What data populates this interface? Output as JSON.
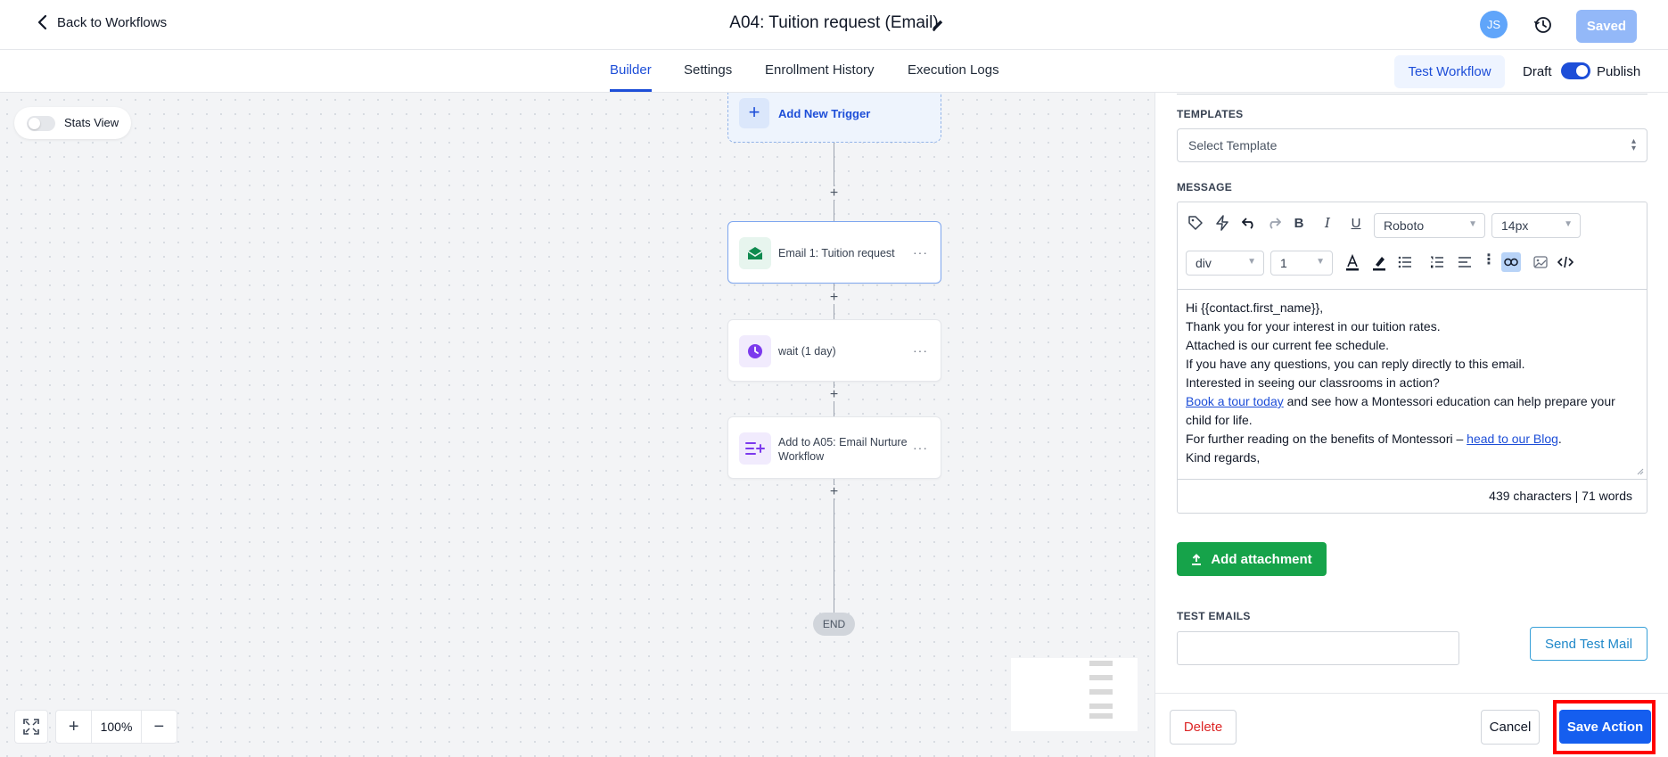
{
  "header": {
    "back_label": "Back to Workflows",
    "title": "A04: Tuition request (Email)",
    "avatar_initials": "JS",
    "saved_label": "Saved"
  },
  "tabs": [
    {
      "label": "Builder",
      "active": true
    },
    {
      "label": "Settings",
      "active": false
    },
    {
      "label": "Enrollment History",
      "active": false
    },
    {
      "label": "Execution Logs",
      "active": false
    }
  ],
  "tabbar_right": {
    "test_workflow_label": "Test Workflow",
    "draft_label": "Draft",
    "publish_label": "Publish",
    "publish_toggle_on": true
  },
  "canvas": {
    "stats_view_label": "Stats View",
    "stats_view_on": false,
    "trigger_label": "Add New Trigger",
    "nodes": [
      {
        "label": "Email 1: Tuition request",
        "icon": "envelope-open-icon",
        "color": "#0f8a4f"
      },
      {
        "label": "wait (1 day)",
        "icon": "clock-icon",
        "color": "#7c3aed"
      },
      {
        "label": "Add to A05: Email Nurture Workflow",
        "icon": "list-add-icon",
        "color": "#7c3aed"
      }
    ],
    "end_label": "END",
    "zoom_level": "100%"
  },
  "panel": {
    "templates_label": "TEMPLATES",
    "template_placeholder": "Select Template",
    "message_label": "MESSAGE",
    "font_family": "Roboto",
    "font_size": "14px",
    "block_type": "div",
    "line_height": "1",
    "message": {
      "line1": "Hi {{contact.first_name}},",
      "line2": "Thank you for your interest in our tuition rates.",
      "line3": "Attached is our current fee schedule.",
      "line4": "If you have any questions, you can reply directly to this email.",
      "line5": "Interested in seeing our classrooms in action?",
      "tour_link": "Book a tour today",
      "line6_rest": " and see how a Montessori education can help prepare your child for life.",
      "line7_prefix": "For further reading on the benefits of Montessori – ",
      "blog_link": "head to our Blog",
      "line7_suffix": ".",
      "line8": "Kind regards,"
    },
    "counter": "439 characters | 71 words",
    "attach_label": "Add attachment",
    "test_emails_label": "TEST EMAILS",
    "test_email_value": "",
    "send_test_label": "Send Test Mail",
    "delete_label": "Delete",
    "cancel_label": "Cancel",
    "save_label": "Save Action"
  }
}
